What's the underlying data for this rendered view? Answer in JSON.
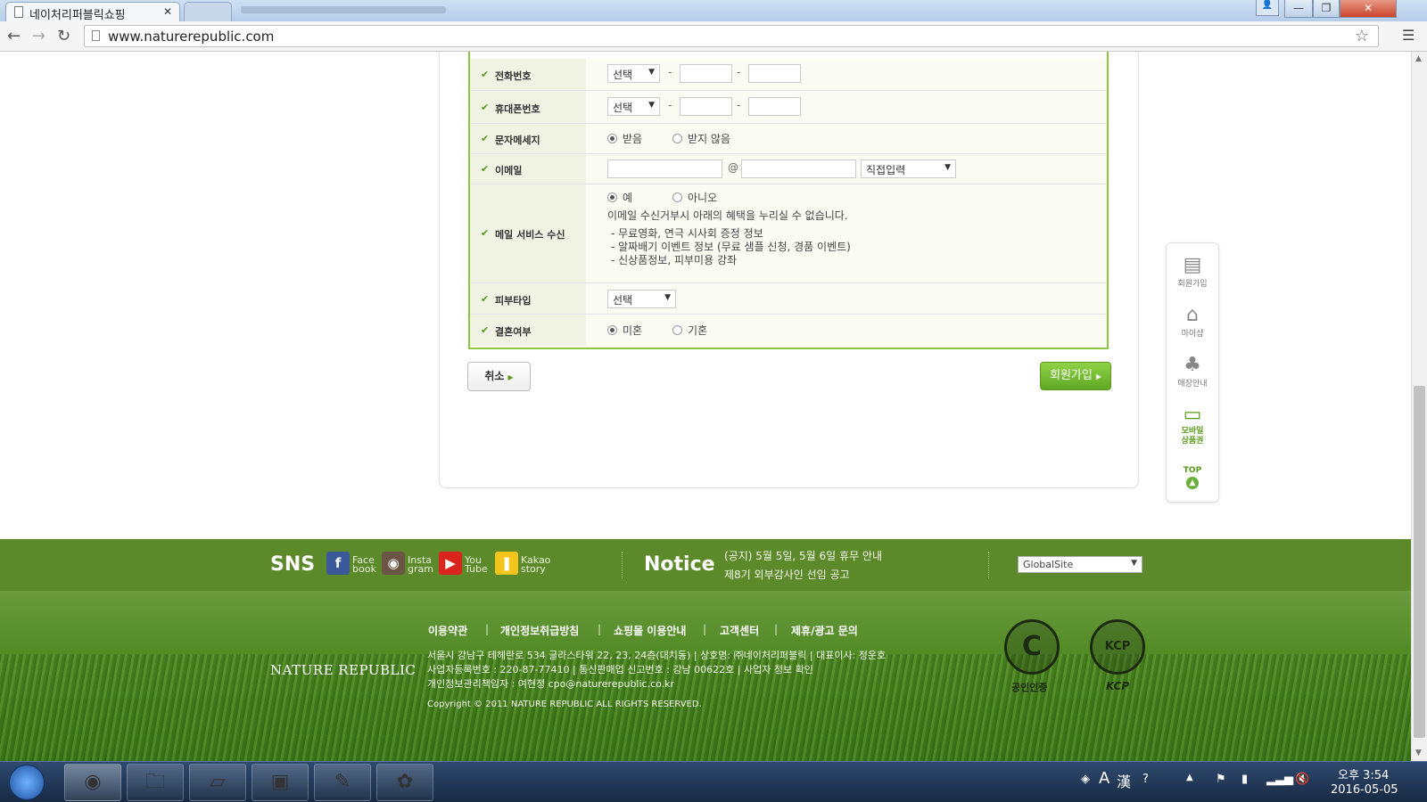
{
  "browser": {
    "tab_title": "네이처리퍼블릭쇼핑",
    "tab_close": "✕",
    "url": "www.naturerepublic.com"
  },
  "form": {
    "rows": {
      "phone": {
        "label": "전화번호",
        "select": "선택"
      },
      "mobile": {
        "label": "휴대폰번호",
        "select": "선택"
      },
      "sms": {
        "label": "문자메세지",
        "opt_yes": "받음",
        "opt_no": "받지 않음"
      },
      "email": {
        "label": "이메일",
        "at": "@",
        "domain_select": "직접입력"
      },
      "mail_service": {
        "label": "메일 서비스 수신",
        "opt_yes": "예",
        "opt_no": "아니오",
        "note": "이메일 수신거부시 아래의 혜택을 누리실 수 없습니다.",
        "benefits": [
          "- 무료영화, 연극 시사회 증정 정보",
          "- 알짜배기 이벤트 정보 (무료 샘플 신청, 경품 이벤트)",
          "- 신상품정보, 피부미용 강좌"
        ]
      },
      "skin": {
        "label": "피부타입",
        "select": "선택"
      },
      "marriage": {
        "label": "결혼여부",
        "opt_single": "미혼",
        "opt_married": "기혼"
      }
    },
    "dash": "-",
    "cancel_label": "취소",
    "join_label": "회원가입"
  },
  "quickmenu": {
    "items": [
      "회원가입",
      "마이샵",
      "매장안내",
      "모바일\n상품권"
    ],
    "top": "TOP"
  },
  "footer": {
    "sns_title": "SNS",
    "sns": [
      {
        "l1": "Face",
        "l2": "book"
      },
      {
        "l1": "Insta",
        "l2": "gram"
      },
      {
        "l1": "You",
        "l2": "Tube"
      },
      {
        "l1": "Kakao",
        "l2": "story"
      }
    ],
    "notice_title": "Notice",
    "notices": [
      "(공지) 5월 5일, 5월 6일 휴무 안내",
      "제8기 외부감사인 선임 공고"
    ],
    "global_site": "GlobalSite",
    "links": [
      "이용약관",
      "개인정보취급방침",
      "쇼핑몰 이용안내",
      "고객센터",
      "제휴/광고 문의"
    ],
    "brand": "NATURE REPUBLIC",
    "info": [
      "서울시 강남구 테헤란로 534 글라스타워 22, 23, 24층(대치동)  |  상호명: ㈜네이처리퍼블릭  |  대표이사: 정운호",
      "사업자등록번호 : 220-87-77410  |  통신판매업 신고번호 : 강남 00622호  |  사업자 정보 확인",
      "개인정보관리책임자 : 여현정 cpo@naturerepublic.co.kr"
    ],
    "copyright": "Copyright © 2011 NATURE REPUBLIC ALL RIGHTS RESERVED.",
    "seal1_label": "공인인증",
    "seal2_label": "KCP",
    "seal2_text": "KCP"
  },
  "taskbar": {
    "time": "오후 3:54",
    "date": "2016-05-05",
    "ime1": "A",
    "ime2": "漢"
  },
  "colors": {
    "accent_green": "#8cc63f",
    "footer_green": "#5c8a2a"
  }
}
